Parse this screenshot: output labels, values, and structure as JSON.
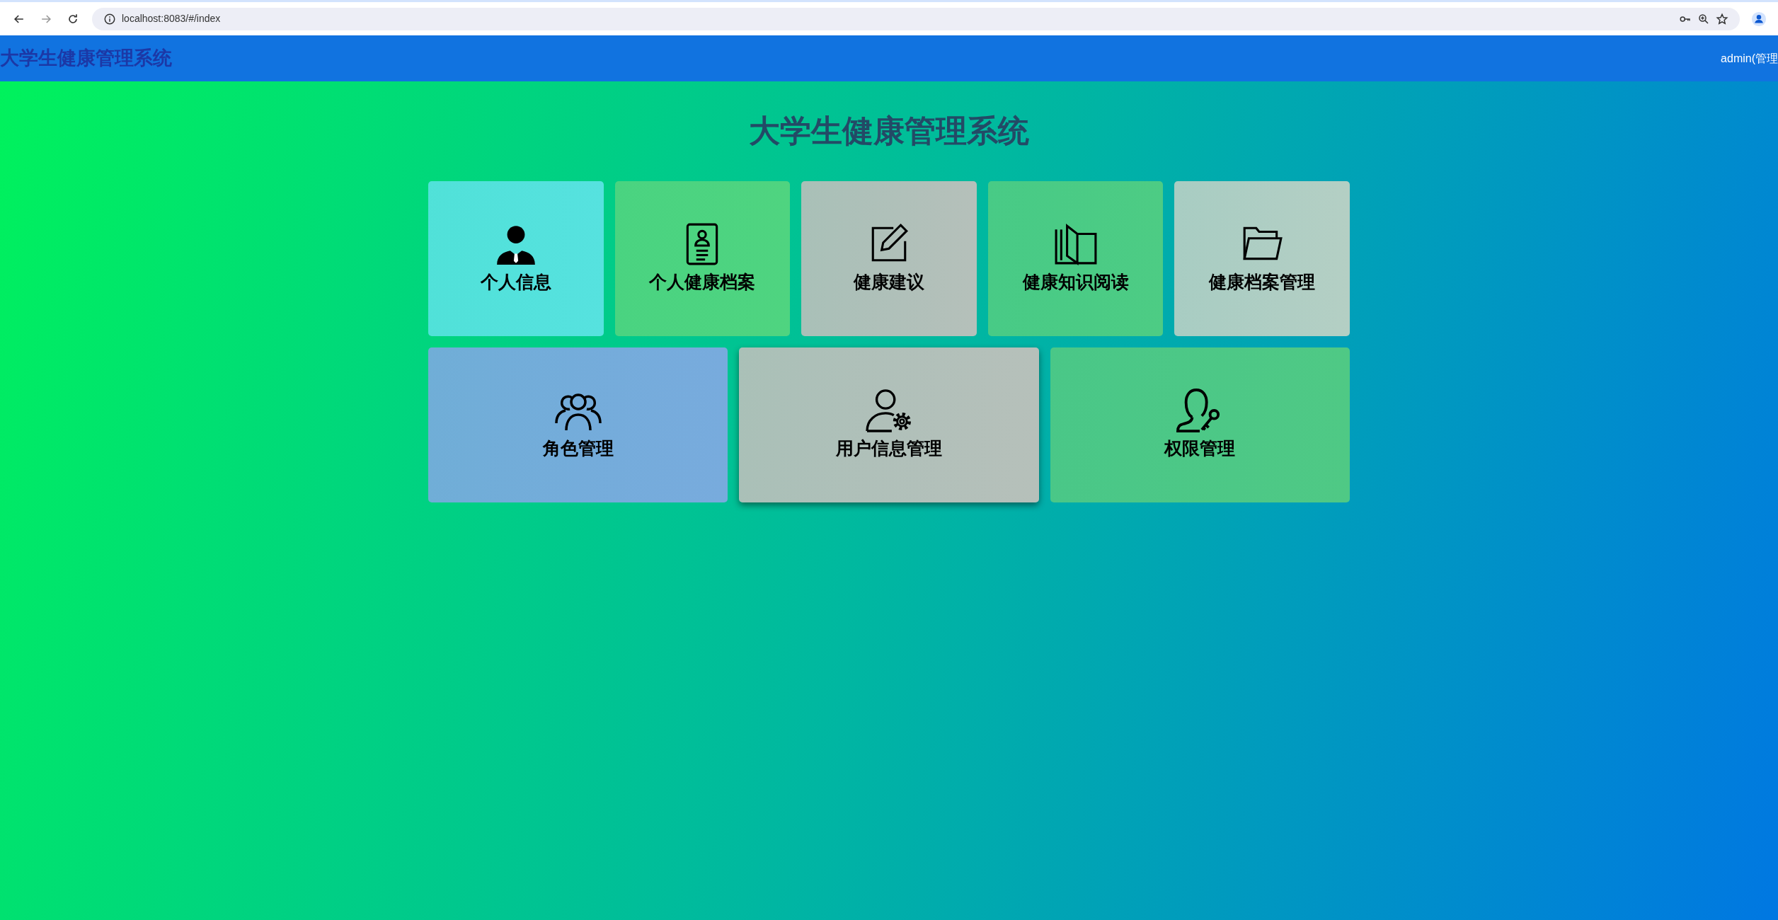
{
  "browser": {
    "url": "localhost:8083/#/index"
  },
  "header": {
    "title": "大学生健康管理系统",
    "user": "admin(管理"
  },
  "page_title": "大学生健康管理系统",
  "tile_rows": [
    {
      "tiles": [
        {
          "label": "个人信息",
          "kind": "person",
          "color": "#56e2df",
          "hovered": false
        },
        {
          "label": "个人健康档案",
          "kind": "idcard",
          "color": "#4fd480",
          "hovered": false
        },
        {
          "label": "健康建议",
          "kind": "edit",
          "color": "#b5c0ba",
          "hovered": false
        },
        {
          "label": "健康知识阅读",
          "kind": "book",
          "color": "#4dcc84",
          "hovered": false
        },
        {
          "label": "健康档案管理",
          "kind": "folder",
          "color": "#b4cfc4",
          "hovered": false
        }
      ]
    },
    {
      "tiles": [
        {
          "label": "角色管理",
          "kind": "group",
          "color": "#78abdd",
          "hovered": false
        },
        {
          "label": "用户信息管理",
          "kind": "usergear",
          "color": "#b6c0ba",
          "hovered": true
        },
        {
          "label": "权限管理",
          "kind": "userkey",
          "color": "#4fc985",
          "hovered": false
        }
      ]
    }
  ]
}
